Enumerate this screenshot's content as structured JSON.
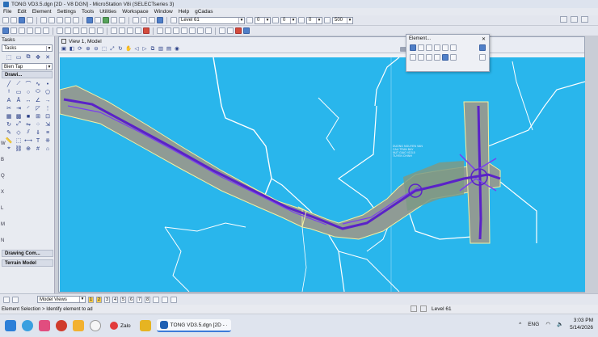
{
  "window": {
    "title": "TONG VD3.5.dgn [2D - V8 DGN] - MicroStation V8i (SELECTseries 3)"
  },
  "menu": [
    "File",
    "Edit",
    "Element",
    "Settings",
    "Tools",
    "Utilities",
    "Workspace",
    "Window",
    "Help",
    "gCadas"
  ],
  "attributes_toolbar": {
    "level": "Level 61",
    "color": "0",
    "style": "0",
    "weight": "0",
    "extra": "500"
  },
  "tasks_panel": {
    "title": "Tasks",
    "combo": "Tasks",
    "group1": "Bien Tap",
    "group2": "Drawi...",
    "letters": [
      "W",
      "B",
      "Q",
      "X",
      "L",
      "M",
      "N"
    ],
    "drawing_composition": "Drawing Com...",
    "terrain_model": "Terrain Model"
  },
  "view": {
    "title": "View 1, Model",
    "annotation": [
      "DUONG NGUYEN VAN",
      "CAU TRAN BAY",
      "NUT GIAO VD3.5",
      "TUYEN CHINH"
    ]
  },
  "element_dialog": {
    "title": "Element..."
  },
  "bottom": {
    "model_views": "Model Views",
    "view_numbers": [
      "1",
      "2",
      "3",
      "4",
      "5",
      "6",
      "7",
      "8"
    ]
  },
  "status": {
    "prompt": "Element Selection > Identify element to ad",
    "level": "Level 61"
  },
  "taskbar": {
    "zalo": "Zalo",
    "app": "TONG VD3.5.dgn [2D - ·",
    "lang": "ENG",
    "time": "3:03 PM",
    "date": "5/14/2026"
  },
  "colors": {
    "canvas_bg": "#29b6ec",
    "road_purple": "#5a22c8",
    "aerial_gray": "#8f9b95",
    "boundary_white": "#ffffff",
    "boundary_yellow": "#f4f0a0"
  }
}
